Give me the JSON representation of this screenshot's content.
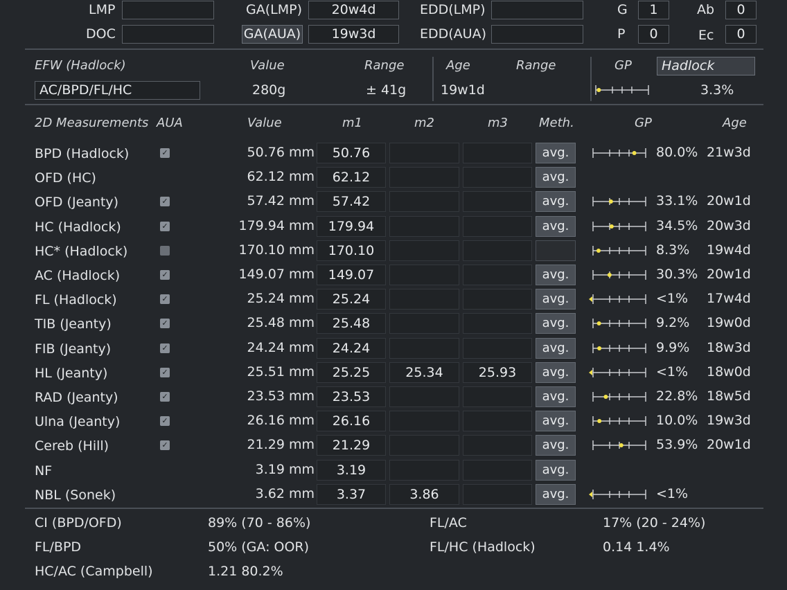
{
  "header": {
    "lmp_label": "LMP",
    "doc_label": "DOC",
    "lmp_value": "",
    "doc_value": "",
    "ga_lmp_label": "GA(LMP)",
    "ga_lmp_value": "20w4d",
    "ga_aua_label": "GA(AUA)",
    "ga_aua_value": "19w3d",
    "edd_lmp_label": "EDD(LMP)",
    "edd_lmp_value": "",
    "edd_aua_label": "EDD(AUA)",
    "edd_aua_value": "",
    "g_label": "G",
    "g_value": "1",
    "p_label": "P",
    "p_value": "0",
    "ab_label": "Ab",
    "ab_value": "0",
    "ec_label": "Ec",
    "ec_value": "0"
  },
  "efw": {
    "title": "EFW (Hadlock)",
    "value_header": "Value",
    "range_header": "Range",
    "age_header": "Age",
    "age_range_header": "Range",
    "gp_header": "GP",
    "gp_method": "Hadlock",
    "formula": "AC/BPD/FL/HC",
    "value": "280g",
    "range": "± 41g",
    "age": "19w1d",
    "gp": "3.3%",
    "gp_level": 0.033
  },
  "measurements": {
    "headers": {
      "name": "2D Measurements",
      "aua": "AUA",
      "value": "Value",
      "m1": "m1",
      "m2": "m2",
      "m3": "m3",
      "meth": "Meth.",
      "gp": "GP",
      "age": "Age"
    },
    "rows": [
      {
        "name": "BPD (Hadlock)",
        "aua": true,
        "value": "50.76 mm",
        "m1": "50.76",
        "m2": "",
        "m3": "",
        "meth": "avg.",
        "gp": "80.0%",
        "age": "21w3d",
        "gp_level": 0.8,
        "show_gp": true
      },
      {
        "name": "OFD (HC)",
        "aua": null,
        "value": "62.12 mm",
        "m1": "62.12",
        "m2": "",
        "m3": "",
        "meth": "avg.",
        "gp": "",
        "age": "",
        "gp_level": null,
        "show_gp": false
      },
      {
        "name": "OFD (Jeanty)",
        "aua": true,
        "value": "57.42 mm",
        "m1": "57.42",
        "m2": "",
        "m3": "",
        "meth": "avg.",
        "gp": "33.1%",
        "age": "20w1d",
        "gp_level": 0.331,
        "show_gp": true
      },
      {
        "name": "HC (Hadlock)",
        "aua": true,
        "value": "179.94 mm",
        "m1": "179.94",
        "m2": "",
        "m3": "",
        "meth": "avg.",
        "gp": "34.5%",
        "age": "20w3d",
        "gp_level": 0.345,
        "show_gp": true
      },
      {
        "name": "HC* (Hadlock)",
        "aua": false,
        "value": "170.10 mm",
        "m1": "170.10",
        "m2": "",
        "m3": "",
        "meth": "",
        "gp": "8.3%",
        "age": "19w4d",
        "gp_level": 0.083,
        "show_gp": true
      },
      {
        "name": "AC (Hadlock)",
        "aua": true,
        "value": "149.07 mm",
        "m1": "149.07",
        "m2": "",
        "m3": "",
        "meth": "avg.",
        "gp": "30.3%",
        "age": "20w1d",
        "gp_level": 0.303,
        "show_gp": true
      },
      {
        "name": "FL (Hadlock)",
        "aua": true,
        "value": "25.24 mm",
        "m1": "25.24",
        "m2": "",
        "m3": "",
        "meth": "avg.",
        "gp": "<1%",
        "age": "17w4d",
        "gp_level": 0.0,
        "show_gp": true
      },
      {
        "name": "TIB (Jeanty)",
        "aua": true,
        "value": "25.48 mm",
        "m1": "25.48",
        "m2": "",
        "m3": "",
        "meth": "avg.",
        "gp": "9.2%",
        "age": "19w0d",
        "gp_level": 0.092,
        "show_gp": true
      },
      {
        "name": "FIB (Jeanty)",
        "aua": true,
        "value": "24.24 mm",
        "m1": "24.24",
        "m2": "",
        "m3": "",
        "meth": "avg.",
        "gp": "9.9%",
        "age": "18w3d",
        "gp_level": 0.099,
        "show_gp": true
      },
      {
        "name": "HL (Jeanty)",
        "aua": true,
        "value": "25.51 mm",
        "m1": "25.25",
        "m2": "25.34",
        "m3": "25.93",
        "meth": "avg.",
        "gp": "<1%",
        "age": "18w0d",
        "gp_level": 0.0,
        "show_gp": true
      },
      {
        "name": "RAD (Jeanty)",
        "aua": true,
        "value": "23.53 mm",
        "m1": "23.53",
        "m2": "",
        "m3": "",
        "meth": "avg.",
        "gp": "22.8%",
        "age": "18w5d",
        "gp_level": 0.228,
        "show_gp": true
      },
      {
        "name": "Ulna (Jeanty)",
        "aua": true,
        "value": "26.16 mm",
        "m1": "26.16",
        "m2": "",
        "m3": "",
        "meth": "avg.",
        "gp": "10.0%",
        "age": "19w3d",
        "gp_level": 0.1,
        "show_gp": true
      },
      {
        "name": "Cereb (Hill)",
        "aua": true,
        "value": "21.29 mm",
        "m1": "21.29",
        "m2": "",
        "m3": "",
        "meth": "avg.",
        "gp": "53.9%",
        "age": "20w1d",
        "gp_level": 0.539,
        "show_gp": true
      },
      {
        "name": "NF",
        "aua": null,
        "value": "3.19 mm",
        "m1": "3.19",
        "m2": "",
        "m3": "",
        "meth": "avg.",
        "gp": "",
        "age": "",
        "gp_level": null,
        "show_gp": false
      },
      {
        "name": "NBL (Sonek)",
        "aua": null,
        "value": "3.62 mm",
        "m1": "3.37",
        "m2": "3.86",
        "m3": "",
        "meth": "avg.",
        "gp": "<1%",
        "age": "",
        "gp_level": 0.0,
        "show_gp": true
      }
    ]
  },
  "ratios": {
    "ci_label": "CI (BPD/OFD)",
    "ci_value": "89% (70 - 86%)",
    "fl_bpd_label": "FL/BPD",
    "fl_bpd_value": "50% (GA: OOR)",
    "hc_ac_label": "HC/AC (Campbell)",
    "hc_ac_value": "1.21 80.2%",
    "fl_ac_label": "FL/AC",
    "fl_ac_value": "17% (20 - 24%)",
    "fl_hc_label": "FL/HC (Hadlock)",
    "fl_hc_value": "0.14 1.4%"
  },
  "colors": {
    "background": "#24272b",
    "gp_marker": "#f2e14a"
  }
}
